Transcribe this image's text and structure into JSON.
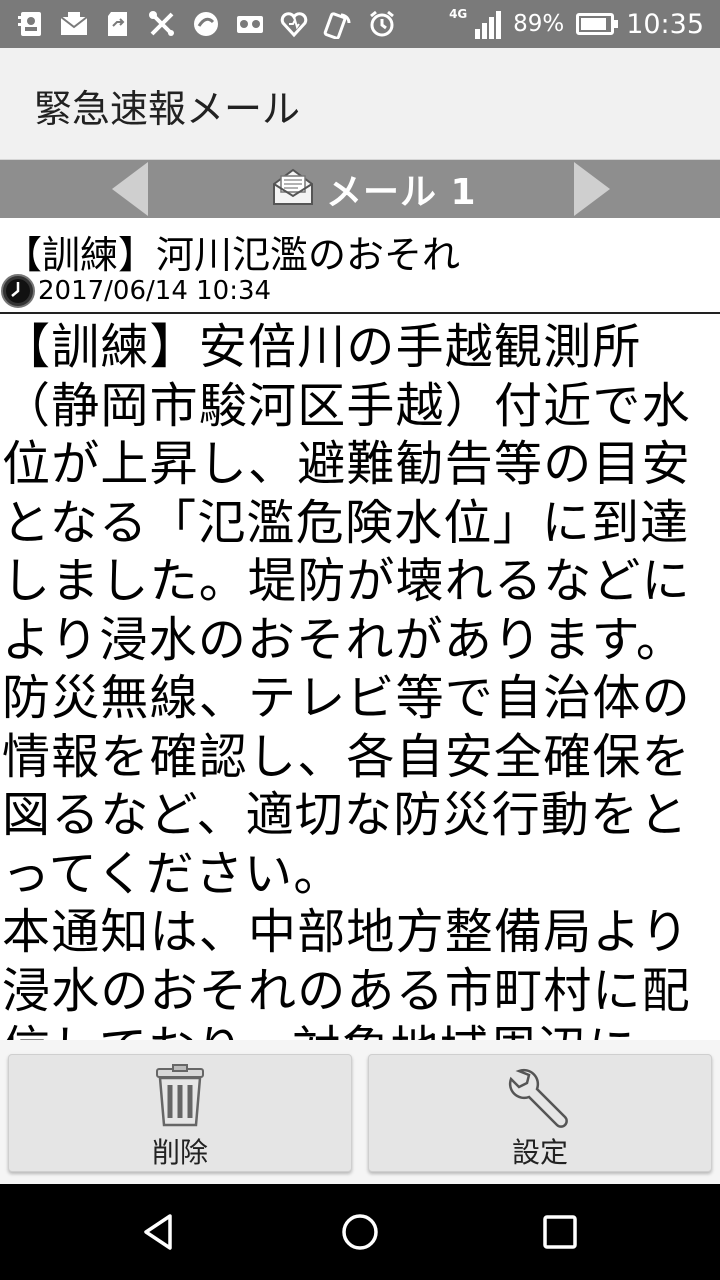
{
  "status_bar": {
    "icons": [
      "contacts-icon",
      "mail-icon",
      "sd-card-icon",
      "tools-icon",
      "sync-icon",
      "voicemail-icon",
      "heart-icon",
      "nfc-icon",
      "alarm-icon"
    ],
    "network": "4G",
    "battery": "89%",
    "battery_level": 0.89,
    "time": "10:35"
  },
  "app": {
    "title": "緊急速報メール"
  },
  "mail_nav": {
    "label": "メール 1"
  },
  "message": {
    "subject": "【訓練】河川氾濫のおそれ",
    "date": "2017/06/14 10:34",
    "body": "【訓練】安倍川の手越観測所（静岡市駿河区手越）付近で水位が上昇し、避難勧告等の目安となる「氾濫危険水位」に到達しました。堤防が壊れるなどにより浸水のおそれがあります。\n防災無線、テレビ等で自治体の情報を確認し、各自安全確保を図るなど、適切な防災行動をとってください。\n本通知は、中部地方整備局より浸水のおそれのある市町村に配信しており、対象地域周辺に"
  },
  "actions": {
    "delete_label": "削除",
    "settings_label": "設定"
  },
  "colors": {
    "status_bar": "#7a7a7a",
    "title_bar": "#f1f1f1",
    "mail_nav": "#8e8e8e",
    "nav_bar": "#000000"
  }
}
